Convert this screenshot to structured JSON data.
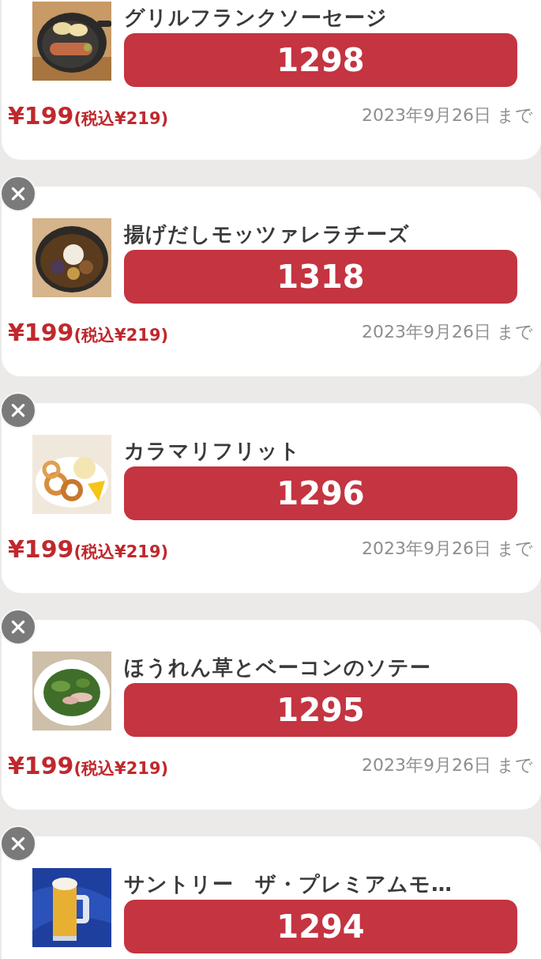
{
  "coupons": [
    {
      "name": "グリルフランクソーセージ",
      "code": "1298",
      "price": "¥199",
      "tax_price": "(税込¥219)",
      "expiry": "2023年9月26日 まで",
      "close_button": false
    },
    {
      "name": "揚げだしモッツァレラチーズ",
      "code": "1318",
      "price": "¥199",
      "tax_price": "(税込¥219)",
      "expiry": "2023年9月26日 まで",
      "close_button": true
    },
    {
      "name": "カラマリフリット",
      "code": "1296",
      "price": "¥199",
      "tax_price": "(税込¥219)",
      "expiry": "2023年9月26日 まで",
      "close_button": true
    },
    {
      "name": "ほうれん草とベーコンのソテー",
      "code": "1295",
      "price": "¥199",
      "tax_price": "(税込¥219)",
      "expiry": "2023年9月26日 まで",
      "close_button": true
    },
    {
      "name": "サントリー　ザ・プレミアムモ…",
      "code": "1294",
      "close_button": true
    }
  ]
}
